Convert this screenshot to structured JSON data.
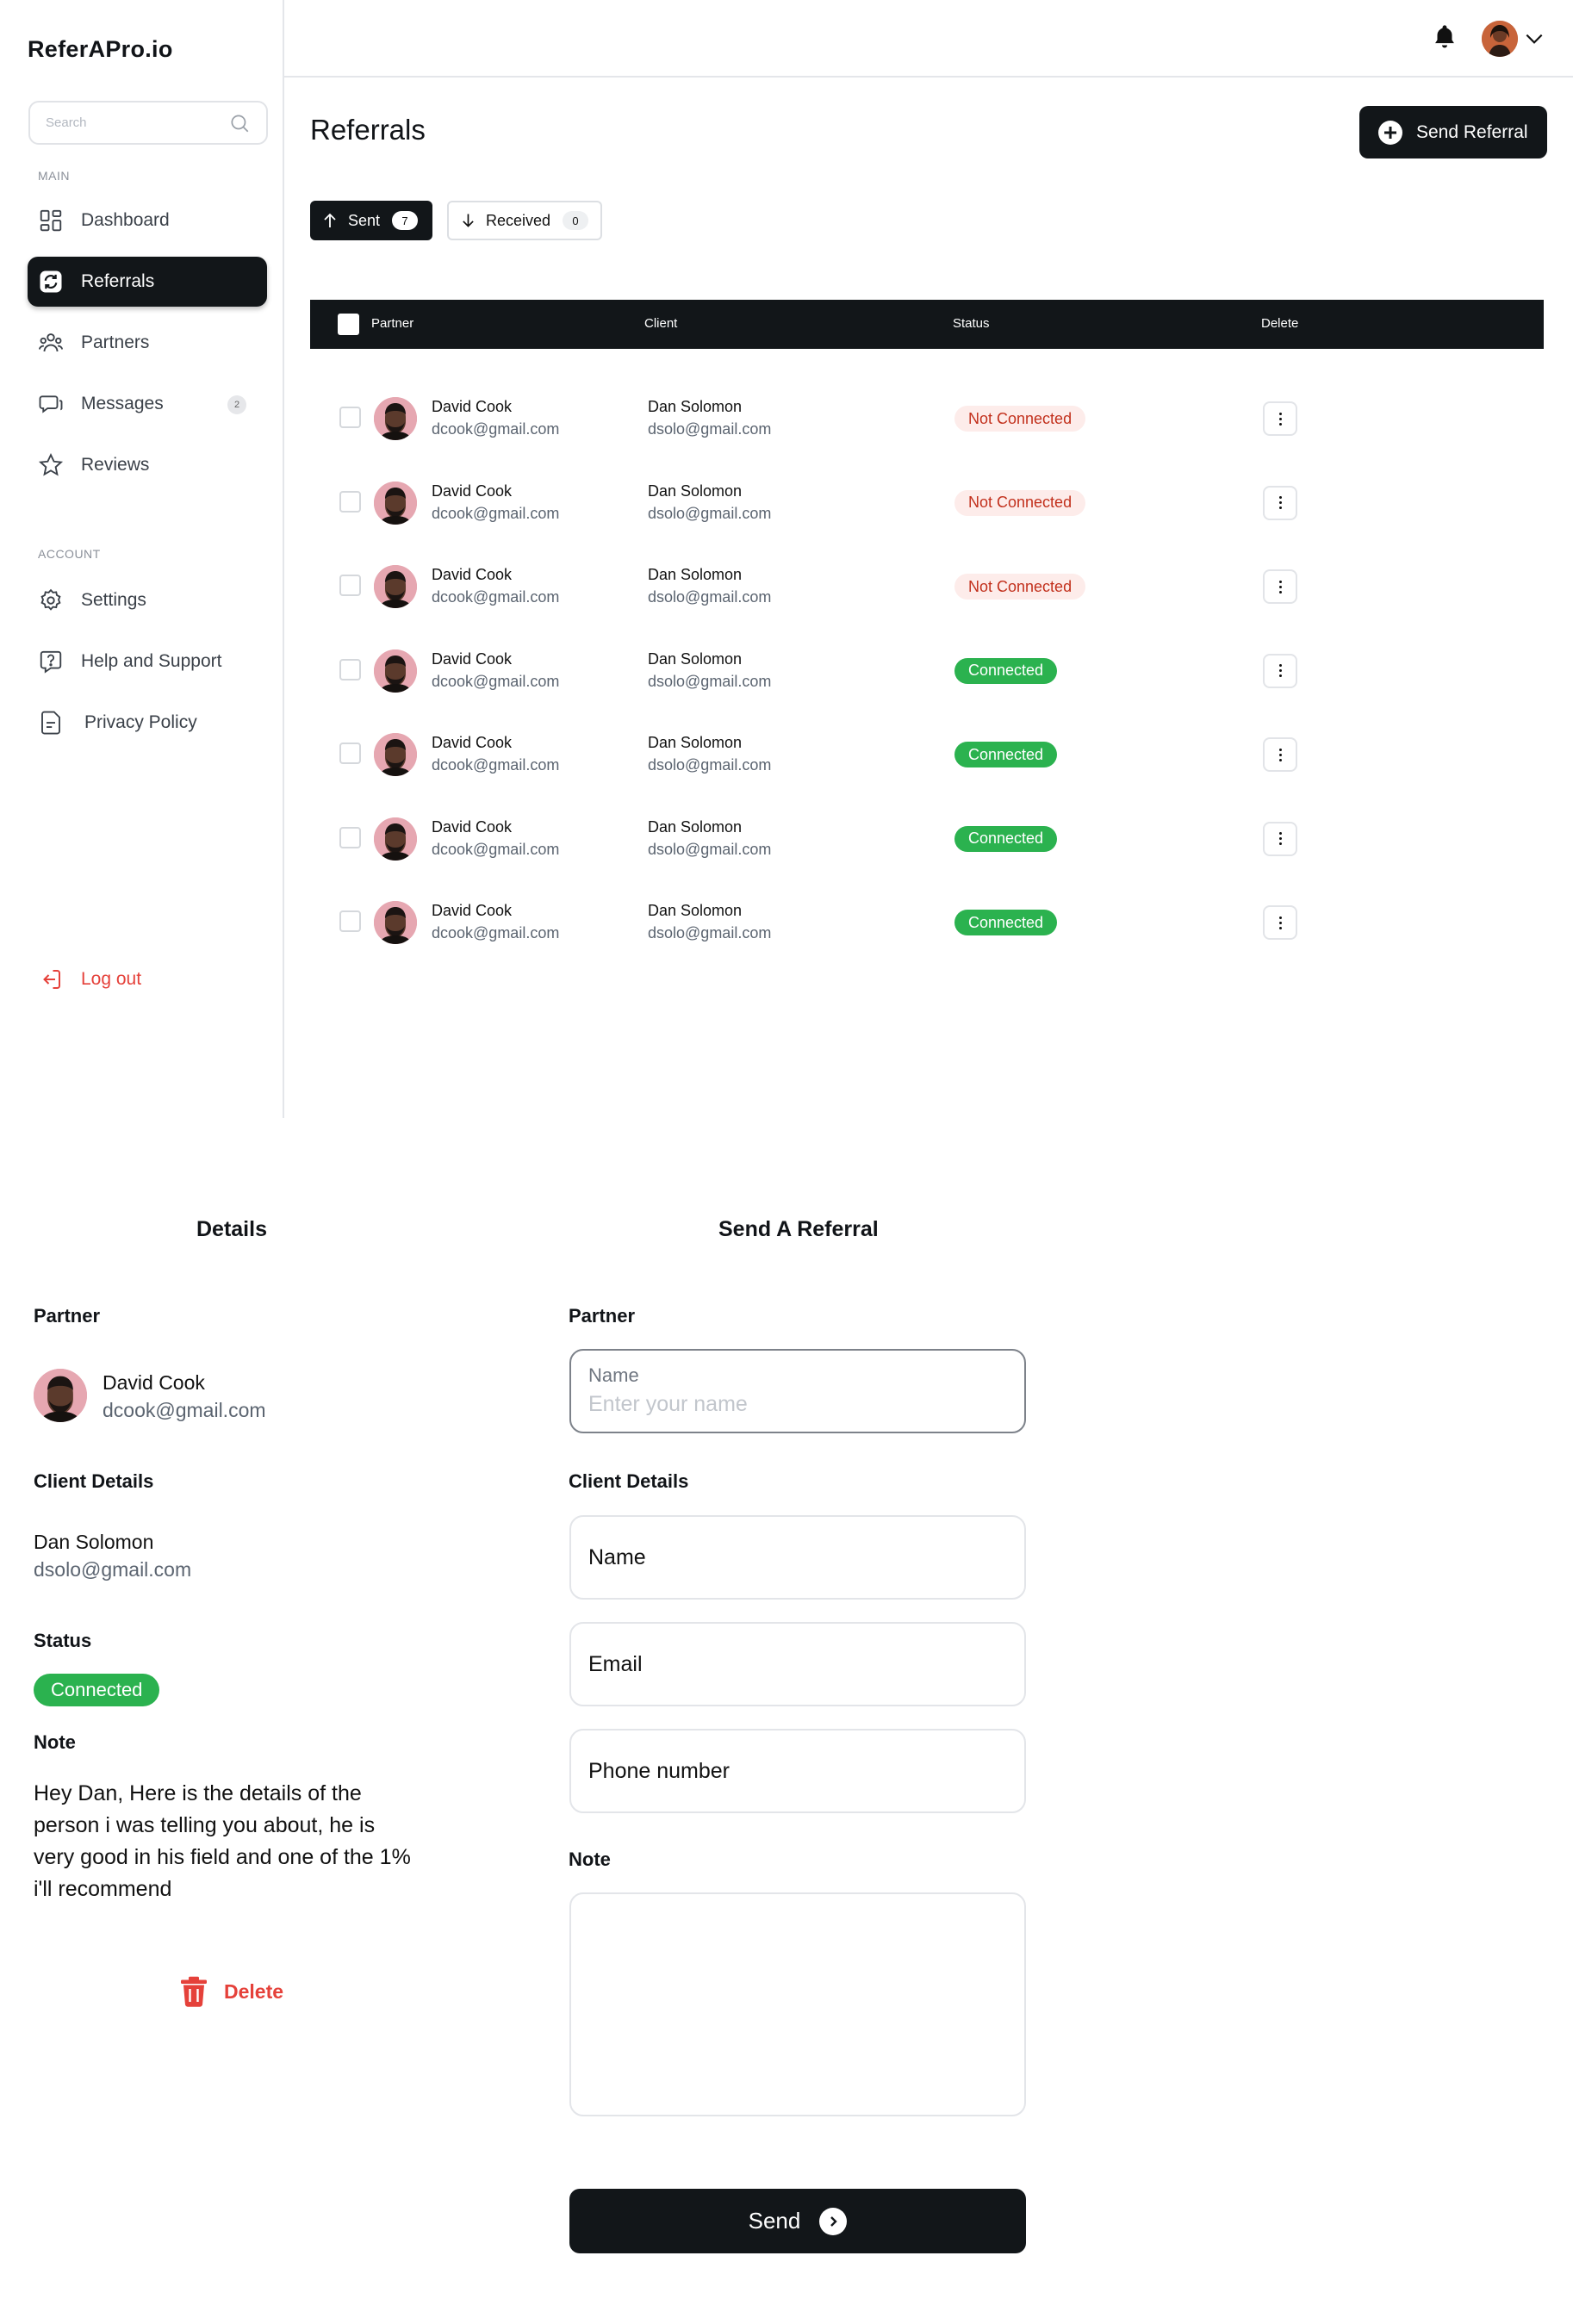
{
  "app": {
    "name": "ReferAPro.io"
  },
  "sidebar": {
    "search_placeholder": "Search",
    "main_label": "MAIN",
    "account_label": "ACCOUNT",
    "items": [
      {
        "label": "Dashboard",
        "icon": "dashboard-icon"
      },
      {
        "label": "Referrals",
        "icon": "referrals-icon",
        "active": true
      },
      {
        "label": "Partners",
        "icon": "partners-icon"
      },
      {
        "label": "Messages",
        "icon": "messages-icon",
        "badge": "2"
      },
      {
        "label": "Reviews",
        "icon": "star-icon"
      }
    ],
    "account_items": [
      {
        "label": "Settings",
        "icon": "gear-icon"
      },
      {
        "label": "Help and Support",
        "icon": "help-icon"
      },
      {
        "label": "Privacy Policy",
        "icon": "document-icon"
      }
    ],
    "logout": "Log out"
  },
  "header": {
    "title": "Referrals",
    "send_button": "Send Referral"
  },
  "tabs": [
    {
      "label": "Sent",
      "count": "7",
      "active": true
    },
    {
      "label": "Received",
      "count": "0"
    }
  ],
  "table": {
    "columns": [
      "Partner",
      "Client",
      "Status",
      "Delete"
    ],
    "rows": [
      {
        "partner_name": "David Cook",
        "partner_email": "dcook@gmail.com",
        "client_name": "Dan Solomon",
        "client_email": "dsolo@gmail.com",
        "status": "Not Connected"
      },
      {
        "partner_name": "David Cook",
        "partner_email": "dcook@gmail.com",
        "client_name": "Dan Solomon",
        "client_email": "dsolo@gmail.com",
        "status": "Not Connected"
      },
      {
        "partner_name": "David Cook",
        "partner_email": "dcook@gmail.com",
        "client_name": "Dan Solomon",
        "client_email": "dsolo@gmail.com",
        "status": "Not Connected"
      },
      {
        "partner_name": "David Cook",
        "partner_email": "dcook@gmail.com",
        "client_name": "Dan Solomon",
        "client_email": "dsolo@gmail.com",
        "status": "Connected"
      },
      {
        "partner_name": "David Cook",
        "partner_email": "dcook@gmail.com",
        "client_name": "Dan Solomon",
        "client_email": "dsolo@gmail.com",
        "status": "Connected"
      },
      {
        "partner_name": "David Cook",
        "partner_email": "dcook@gmail.com",
        "client_name": "Dan Solomon",
        "client_email": "dsolo@gmail.com",
        "status": "Connected"
      },
      {
        "partner_name": "David Cook",
        "partner_email": "dcook@gmail.com",
        "client_name": "Dan Solomon",
        "client_email": "dsolo@gmail.com",
        "status": "Connected"
      }
    ]
  },
  "details": {
    "title": "Details",
    "partner_label": "Partner",
    "partner_name": "David Cook",
    "partner_email": "dcook@gmail.com",
    "client_label": "Client Details",
    "client_name": "Dan Solomon",
    "client_email": "dsolo@gmail.com",
    "status_label": "Status",
    "status": "Connected",
    "note_label": "Note",
    "note": "Hey Dan, Here is the details of the person i was telling you about, he is very good in his field and one of the 1% i'll recommend",
    "delete": "Delete"
  },
  "form": {
    "title": "Send A Referral",
    "partner_label": "Partner",
    "partner_field_label": "Name",
    "partner_placeholder": "Enter your name",
    "client_label": "Client Details",
    "name_field": "Name",
    "email_field": "Email",
    "phone_field": "Phone number",
    "note_label": "Note",
    "send": "Send"
  },
  "colors": {
    "dark": "#121619",
    "connected": "#2bb24f",
    "not_connected_bg": "#fdecea",
    "not_connected_text": "#c2301c",
    "danger": "#e5413a"
  }
}
